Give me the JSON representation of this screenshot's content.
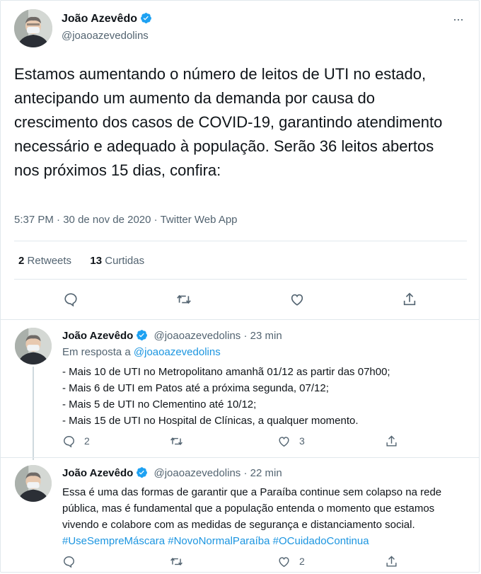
{
  "main_tweet": {
    "author_name": "João Azevêdo",
    "author_handle": "@joaoazevedolins",
    "text": "Estamos aumentando o número de leitos de UTI no estado, antecipando um aumento da demanda por causa do crescimento dos casos de COVID-19, garantindo atendimento necessário e adequado à população. Serão 36 leitos abertos nos próximos 15 dias, confira:",
    "time": "5:37 PM",
    "date": "30 de nov de 2020",
    "source": "Twitter Web App",
    "retweets_count": "2",
    "retweets_label": "Retweets",
    "likes_count": "13",
    "likes_label": "Curtidas"
  },
  "reply1": {
    "author_name": "João Azevêdo",
    "author_handle": "@joaoazevedolins",
    "time": "23 min",
    "reply_to_prefix": "Em resposta a",
    "reply_to_handle": "@joaoazevedolins",
    "lines": [
      "- Mais 10 de UTI no Metropolitano amanhã 01/12 as partir das 07h00;",
      "- Mais 6 de UTI em Patos até a próxima segunda, 07/12;",
      "- Mais 5 de UTI no Clementino até 10/12;",
      "- Mais 15 de UTI no Hospital de Clínicas, a qualquer momento."
    ],
    "reply_count": "2",
    "like_count": "3"
  },
  "reply2": {
    "author_name": "João Azevêdo",
    "author_handle": "@joaoazevedolins",
    "time": "22 min",
    "text": "Essa é uma das formas de garantir que a Paraíba continue sem colapso na rede pública, mas é fundamental que a população entenda o momento que estamos vivendo e colabore com as medidas de segurança e distanciamento social.",
    "hashtags": [
      "#UseSempreMáscara",
      "#NovoNormalParaíba",
      "#OCuidadoContinua"
    ],
    "like_count": "2"
  },
  "colors": {
    "link": "#1b95e0",
    "verified": "#1da1f2",
    "muted": "#536471",
    "divider": "#e1e8ed"
  },
  "icons": [
    "verified-badge-icon",
    "more-icon",
    "reply-icon",
    "retweet-icon",
    "like-icon",
    "share-icon"
  ]
}
